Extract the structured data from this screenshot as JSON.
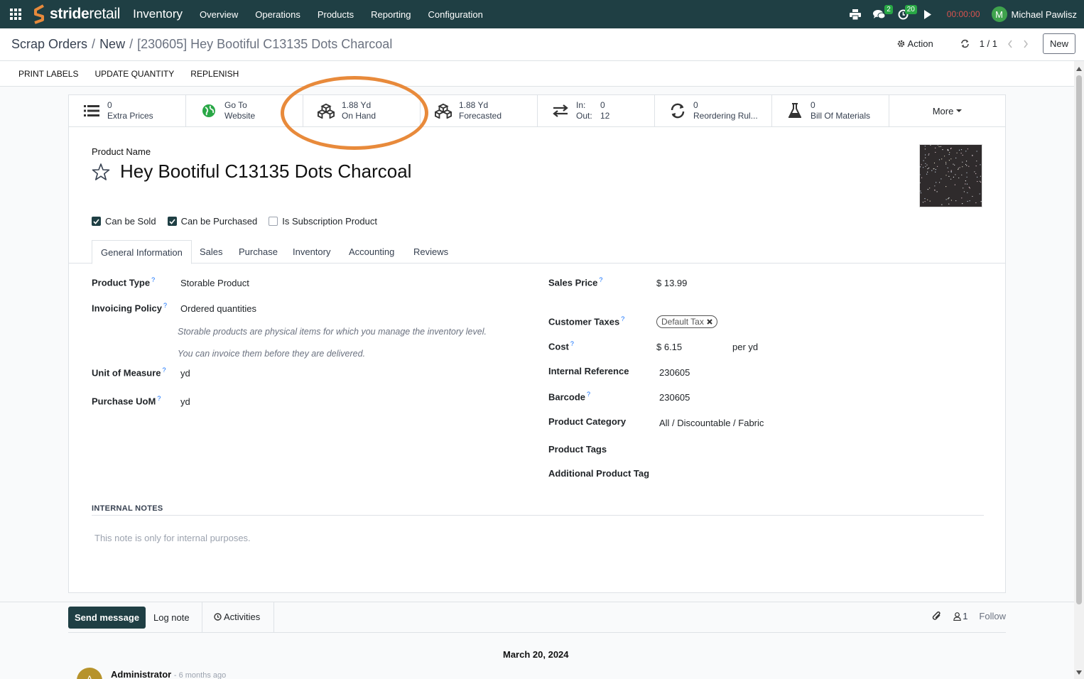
{
  "navbar": {
    "logo_text_bold": "stride",
    "logo_text": "retail",
    "app_name": "Inventory",
    "menu": [
      "Overview",
      "Operations",
      "Products",
      "Reporting",
      "Configuration"
    ],
    "messages_badge": "2",
    "activities_badge": "20",
    "timer": "00:00:00",
    "user_initial": "M",
    "user_name": "Michael Pawlisz"
  },
  "control_panel": {
    "breadcrumb": [
      "Scrap Orders",
      "New"
    ],
    "current": "[230605] Hey Bootiful C13135 Dots Charcoal",
    "action_label": "Action",
    "pager": "1 / 1",
    "new_label": "New"
  },
  "statusbar": {
    "buttons": [
      "PRINT LABELS",
      "UPDATE QUANTITY",
      "REPLENISH"
    ]
  },
  "smart_buttons": {
    "extra_prices": {
      "value": "0",
      "label": "Extra Prices"
    },
    "website": {
      "line1": "Go To",
      "line2": "Website"
    },
    "on_hand": {
      "value": "1.88 Yd",
      "label": "On Hand"
    },
    "forecasted": {
      "value": "1.88 Yd",
      "label": "Forecasted"
    },
    "in_out": {
      "in_label": "In:",
      "in_value": "0",
      "out_label": "Out:",
      "out_value": "12"
    },
    "reordering": {
      "value": "0",
      "label": "Reordering Rul..."
    },
    "bom": {
      "value": "0",
      "label": "Bill Of Materials"
    },
    "more": "More"
  },
  "product": {
    "name_label": "Product Name",
    "name": "Hey Bootiful C13135 Dots Charcoal",
    "can_be_sold": "Can be Sold",
    "can_be_purchased": "Can be Purchased",
    "is_subscription": "Is Subscription Product"
  },
  "tabs": [
    "General Information",
    "Sales",
    "Purchase",
    "Inventory",
    "Accounting",
    "Reviews"
  ],
  "general": {
    "product_type_label": "Product Type",
    "product_type": "Storable Product",
    "invoicing_policy_label": "Invoicing Policy",
    "invoicing_policy": "Ordered quantities",
    "help1": "Storable products are physical items for which you manage the inventory level.",
    "help2": "You can invoice them before they are delivered.",
    "uom_label": "Unit of Measure",
    "uom": "yd",
    "purchase_uom_label": "Purchase UoM",
    "purchase_uom": "yd",
    "sales_price_label": "Sales Price",
    "sales_price": "$ 13.99",
    "customer_taxes_label": "Customer Taxes",
    "customer_tax_tag": "Default Tax",
    "cost_label": "Cost",
    "cost": "$ 6.15",
    "cost_unit": "per yd",
    "internal_ref_label": "Internal Reference",
    "internal_ref": "230605",
    "barcode_label": "Barcode",
    "barcode": "230605",
    "category_label": "Product Category",
    "category": "All / Discountable / Fabric",
    "tags_label": "Product Tags",
    "additional_tag_label": "Additional Product Tag",
    "help_mark": "?"
  },
  "notes": {
    "title": "INTERNAL NOTES",
    "placeholder": "This note is only for internal purposes."
  },
  "chatter": {
    "send_message": "Send message",
    "log_note": "Log note",
    "activities": "Activities",
    "followers_count": "1",
    "follow": "Follow",
    "date": "March 20, 2024",
    "author_initial": "A",
    "author": "Administrator",
    "time": "- 6 months ago"
  },
  "colors": {
    "navbar": "#1f3f44",
    "highlight": "#e88a3b",
    "badge": "#28a745",
    "timer": "#d9534f"
  }
}
